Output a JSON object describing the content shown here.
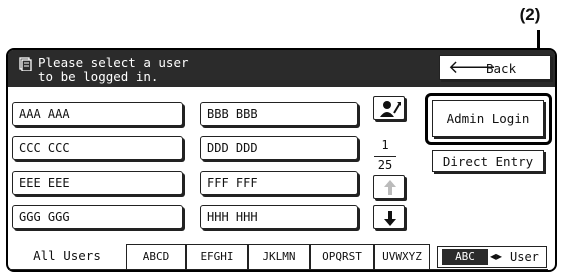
{
  "callout": {
    "label": "(2)"
  },
  "header": {
    "message_line1": "Please select a user",
    "message_line2": "to be logged in.",
    "back_label": "Back"
  },
  "users": [
    {
      "name": "AAA AAA"
    },
    {
      "name": "BBB BBB"
    },
    {
      "name": "CCC CCC"
    },
    {
      "name": "DDD DDD"
    },
    {
      "name": "EEE EEE"
    },
    {
      "name": "FFF FFF"
    },
    {
      "name": "GGG GGG"
    },
    {
      "name": "HHH HHH"
    }
  ],
  "pagination": {
    "current": "1",
    "total": "25"
  },
  "actions": {
    "admin_login_label": "Admin Login",
    "direct_entry_label": "Direct Entry"
  },
  "tabs": [
    "All Users",
    "ABCD",
    "EFGHI",
    "JKLMN",
    "OPQRST",
    "UVWXYZ"
  ],
  "abc_toggle": {
    "abc": "ABC",
    "user": "User"
  },
  "icons": {
    "document": "document-icon",
    "back_arrow": "arrow-left-icon",
    "user_sort": "user-sort-icon",
    "page_up": "arrow-up-icon",
    "page_down": "arrow-down-icon",
    "toggle": "left-right-arrows-icon"
  }
}
